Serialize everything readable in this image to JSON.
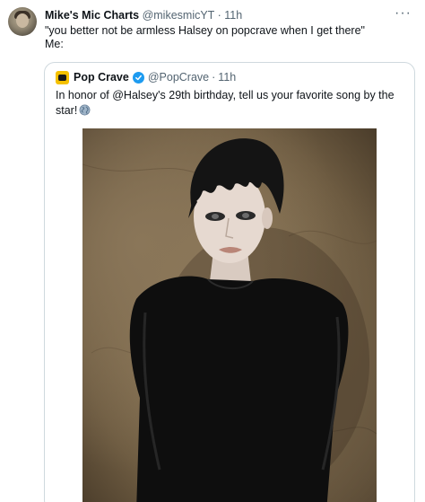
{
  "tweet": {
    "author_name": "Mike's Mic Charts",
    "author_handle": "@mikesmicYT",
    "separator": "·",
    "time": "11h",
    "more_icon": "more-icon",
    "text_line1": "\"you better not be armless Halsey on popcrave when I get there\"",
    "text_line2": "Me:"
  },
  "quote": {
    "author_name": "Pop Crave",
    "author_handle": "@PopCrave",
    "separator": "·",
    "time": "11h",
    "verified_icon": "verified-badge-icon",
    "text_line1": "In honor of @Halsey's 29th birthday, tell us your favorite song by the",
    "text_line2": "star!",
    "emoji": "globe-icon"
  },
  "colors": {
    "text_primary": "#0f1419",
    "text_secondary": "#536471",
    "border": "#cfd9de",
    "verified": "#1d9bf0",
    "pop_crave_brand": "#f5c100"
  }
}
